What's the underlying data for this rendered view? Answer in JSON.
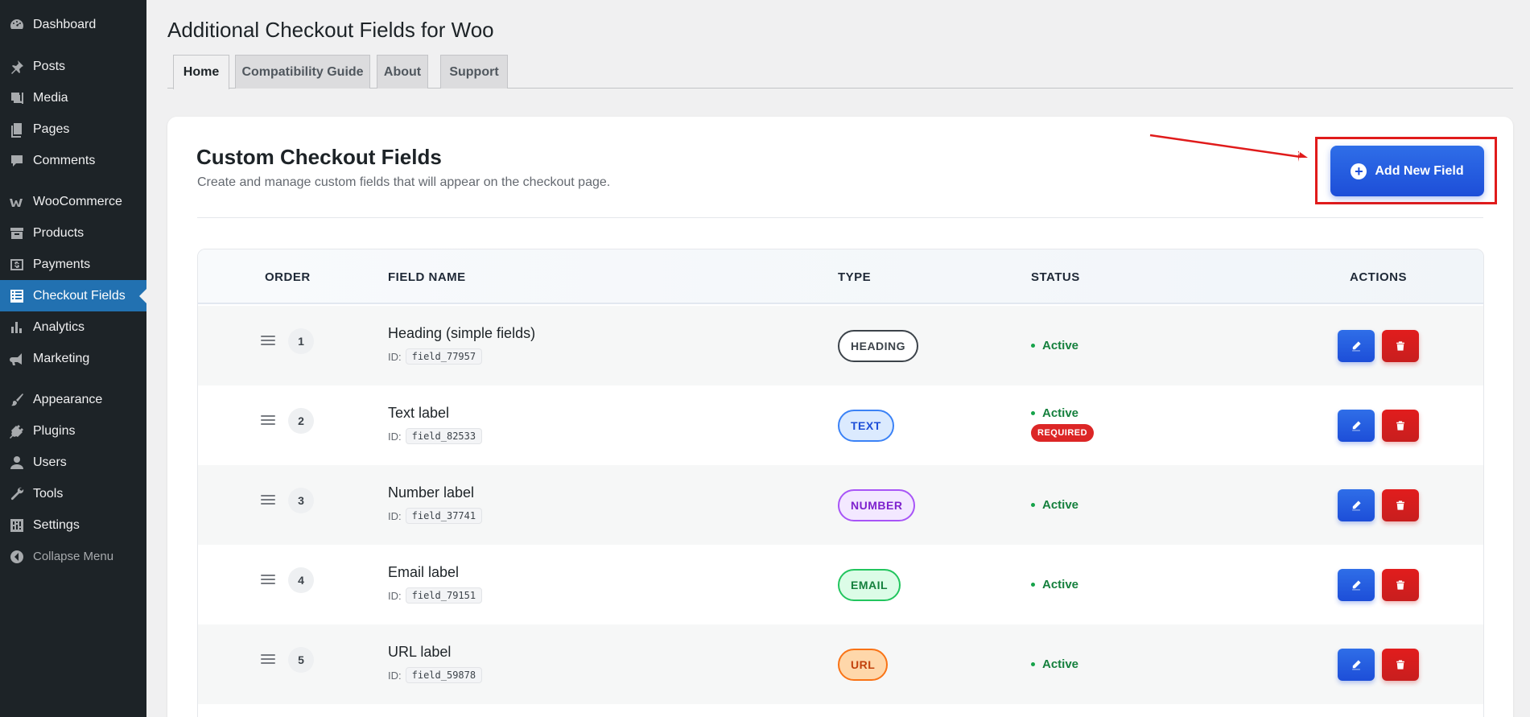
{
  "sidebar": {
    "items": [
      {
        "label": "Dashboard",
        "icon": "dashboard-icon"
      },
      {
        "label": "Posts",
        "icon": "pin-icon"
      },
      {
        "label": "Media",
        "icon": "media-icon"
      },
      {
        "label": "Pages",
        "icon": "pages-icon"
      },
      {
        "label": "Comments",
        "icon": "comment-icon"
      },
      {
        "label": "WooCommerce",
        "icon": "woo-icon"
      },
      {
        "label": "Products",
        "icon": "archive-icon"
      },
      {
        "label": "Payments",
        "icon": "money-icon"
      },
      {
        "label": "Checkout Fields",
        "icon": "list-icon"
      },
      {
        "label": "Analytics",
        "icon": "chart-bar-icon"
      },
      {
        "label": "Marketing",
        "icon": "megaphone-icon"
      },
      {
        "label": "Appearance",
        "icon": "brush-icon"
      },
      {
        "label": "Plugins",
        "icon": "plugin-icon"
      },
      {
        "label": "Users",
        "icon": "user-icon"
      },
      {
        "label": "Tools",
        "icon": "wrench-icon"
      },
      {
        "label": "Settings",
        "icon": "settings-icon"
      },
      {
        "label": "Collapse Menu",
        "icon": "collapse-icon"
      }
    ],
    "active": "Checkout Fields"
  },
  "header": {
    "title": "Additional Checkout Fields for Woo",
    "tabs": [
      "Home",
      "Compatibility Guide",
      "About",
      "Support"
    ],
    "active_tab": "Home"
  },
  "main": {
    "title": "Custom Checkout Fields",
    "subtitle": "Create and manage custom fields that will appear on the checkout page.",
    "add_button_label": "Add New Field",
    "table": {
      "columns": [
        "ORDER",
        "FIELD NAME",
        "TYPE",
        "STATUS",
        "ACTIONS"
      ],
      "id_prefix": "ID:",
      "rows": [
        {
          "order": "1",
          "name": "Heading (simple fields)",
          "id": "field_77957",
          "type": "HEADING",
          "status": "Active",
          "required": ""
        },
        {
          "order": "2",
          "name": "Text label",
          "id": "field_82533",
          "type": "TEXT",
          "status": "Active",
          "required": "REQUIRED"
        },
        {
          "order": "3",
          "name": "Number label",
          "id": "field_37741",
          "type": "NUMBER",
          "status": "Active",
          "required": ""
        },
        {
          "order": "4",
          "name": "Email label",
          "id": "field_79151",
          "type": "EMAIL",
          "status": "Active",
          "required": ""
        },
        {
          "order": "5",
          "name": "URL label",
          "id": "field_59878",
          "type": "URL",
          "status": "Active",
          "required": ""
        }
      ]
    }
  },
  "colors": {
    "sidebar_bg": "#1d2327",
    "active_menu": "#2271b1",
    "primary": "#1d4ed8",
    "danger": "#dc2626",
    "success": "#15803d",
    "highlight_annotation": "#e01b1b",
    "type_badges": {
      "HEADING": {
        "border": "#3c434a",
        "bg": "#ffffff",
        "text": "#3c434a"
      },
      "TEXT": {
        "border": "#3b82f6",
        "bg": "#dbeafe",
        "text": "#1d4ed8"
      },
      "NUMBER": {
        "border": "#a855f7",
        "bg": "#f3e8ff",
        "text": "#7e22ce"
      },
      "EMAIL": {
        "border": "#22c55e",
        "bg": "#dcfce7",
        "text": "#15803d"
      },
      "URL": {
        "border": "#f97316",
        "bg": "#fed7aa",
        "text": "#c2410c"
      }
    }
  }
}
